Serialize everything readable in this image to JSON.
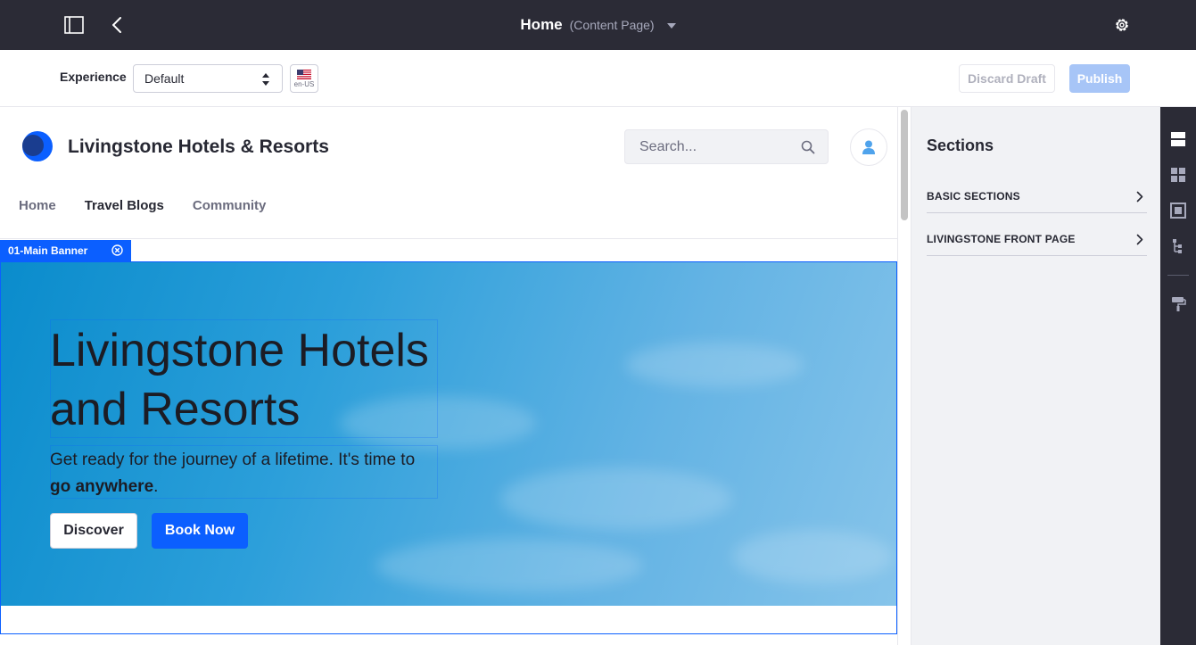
{
  "topbar": {
    "title": "Home",
    "subtitle": "(Content Page)"
  },
  "toolbar": {
    "experience_label": "Experience",
    "experience_value": "Default",
    "language_code": "en-US",
    "discard_label": "Discard Draft",
    "publish_label": "Publish"
  },
  "site": {
    "name": "Livingstone Hotels & Resorts",
    "search_placeholder": "Search...",
    "nav": [
      {
        "label": "Home"
      },
      {
        "label": "Travel Blogs"
      },
      {
        "label": "Community"
      }
    ]
  },
  "fragment": {
    "tag_label": "01-Main Banner"
  },
  "hero": {
    "title": "Livingstone Hotels and Resorts",
    "subtitle_prefix": "Get ready for the journey of a lifetime. It's time to ",
    "subtitle_bold": "go anywhere",
    "subtitle_suffix": ".",
    "discover_label": "Discover",
    "book_label": "Book Now"
  },
  "panel": {
    "title": "Sections",
    "items": [
      {
        "label": "BASIC SECTIONS"
      },
      {
        "label": "LIVINGSTONE FRONT PAGE"
      }
    ]
  },
  "colors": {
    "primary": "#0b5fff",
    "dark_bar": "#2b2b36",
    "publish_disabled": "#a7c5f7"
  },
  "icons": {
    "rail": [
      "sections-icon",
      "widgets-icon",
      "fragment-icon",
      "page-structure-icon",
      "look-and-feel-icon"
    ]
  }
}
